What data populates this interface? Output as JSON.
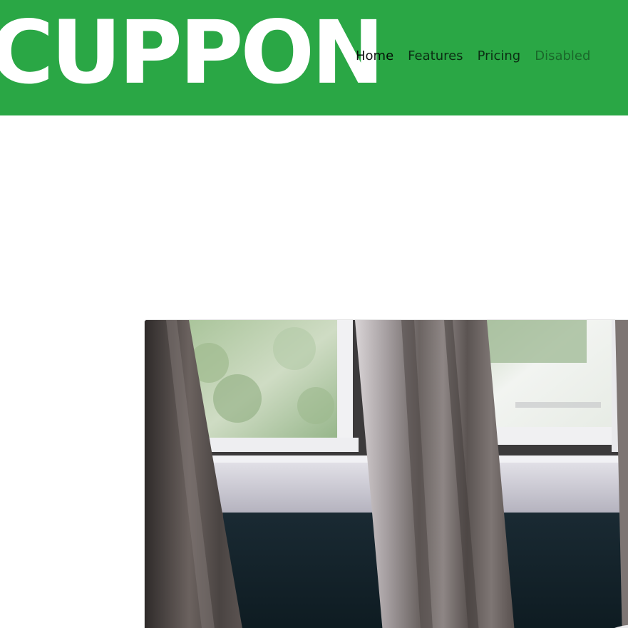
{
  "navbar": {
    "brand": "CUPPON",
    "background_color": "#2aa745",
    "links": [
      {
        "label": "Home",
        "state": "active"
      },
      {
        "label": "Features",
        "state": "normal"
      },
      {
        "label": "Pricing",
        "state": "normal"
      },
      {
        "label": "Disabled",
        "state": "disabled"
      }
    ]
  },
  "main": {
    "image": {
      "subject": "window with curtains"
    }
  }
}
